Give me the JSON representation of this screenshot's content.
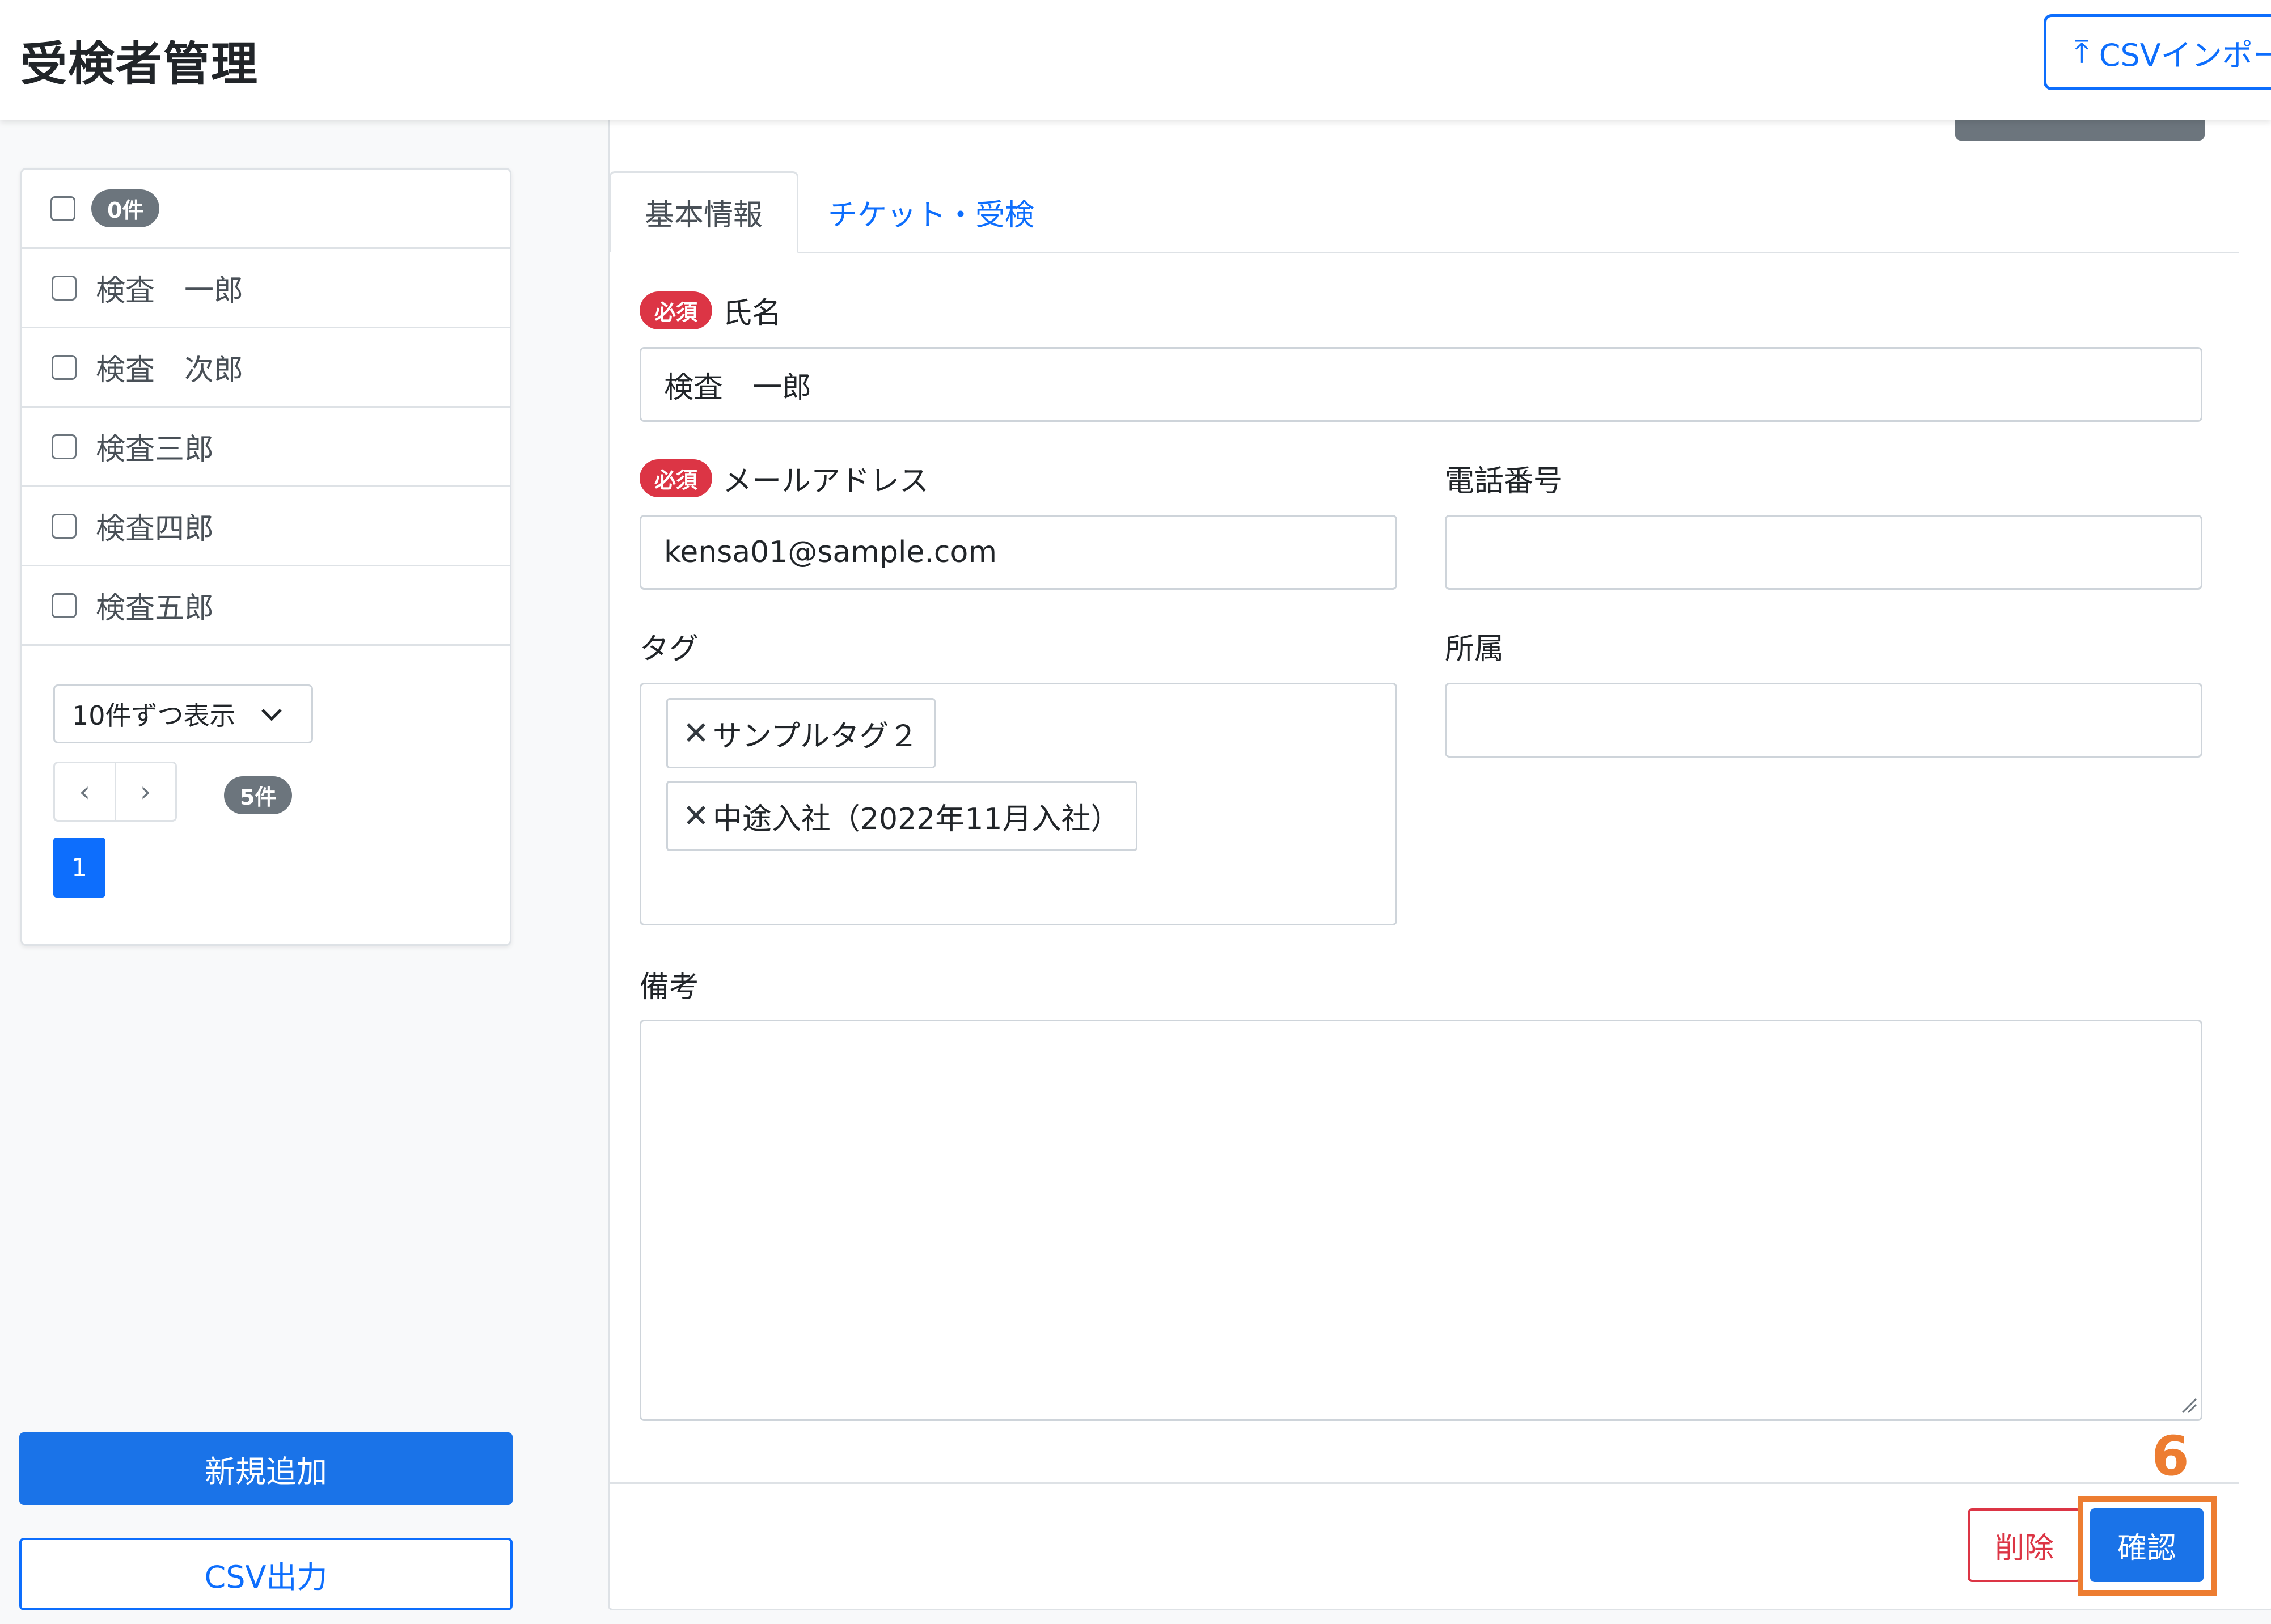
{
  "header": {
    "title": "受検者管理",
    "csv_import_label": "CSVインポート"
  },
  "list": {
    "selected_count": "0件",
    "items": [
      {
        "label": "検査　一郎"
      },
      {
        "label": "検査　次郎"
      },
      {
        "label": "検査三郎"
      },
      {
        "label": "検査四郎"
      },
      {
        "label": "検査五郎"
      }
    ],
    "per_page": "10件ずつ表示",
    "prev": "‹",
    "next": "›",
    "total": "5件",
    "current_page": "1"
  },
  "sidebar_actions": {
    "new_label": "新規追加",
    "csv_export_label": "CSV出力"
  },
  "tabs": [
    {
      "label": "基本情報",
      "active": true
    },
    {
      "label": "チケット・受検",
      "active": false
    }
  ],
  "form": {
    "required_badge": "必須",
    "name_label": "氏名",
    "name_value": "検査　一郎",
    "email_label": "メールアドレス",
    "email_value": "kensa01@sample.com",
    "phone_label": "電話番号",
    "phone_value": "",
    "tag_label": "タグ",
    "tags": [
      {
        "label": "サンプルタグ２"
      },
      {
        "label": "中途入社（2022年11月入社）"
      }
    ],
    "affiliation_label": "所属",
    "affiliation_value": "",
    "notes_label": "備考",
    "notes_value": ""
  },
  "footer": {
    "delete_label": "削除",
    "confirm_label": "確認"
  },
  "annotation": {
    "step_number": "6",
    "color": "#ed7d31"
  },
  "colors": {
    "primary": "#0d6efd",
    "danger": "#dc3545",
    "secondary": "#6c757d"
  }
}
